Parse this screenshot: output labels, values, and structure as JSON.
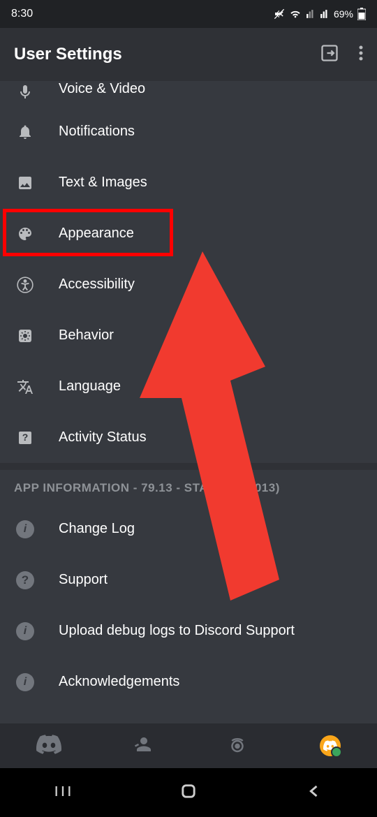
{
  "status": {
    "time": "8:30",
    "battery": "69%"
  },
  "header": {
    "title": "User Settings"
  },
  "items": {
    "voice_video": "Voice & Video",
    "notifications": "Notifications",
    "text_images": "Text & Images",
    "appearance": "Appearance",
    "accessibility": "Accessibility",
    "behavior": "Behavior",
    "language": "Language",
    "activity_status": "Activity Status"
  },
  "section": {
    "app_info": "APP INFORMATION - 79.13 - STABLE (79013)"
  },
  "info_items": {
    "change_log": "Change Log",
    "support": "Support",
    "upload_logs": "Upload debug logs to Discord Support",
    "acknowledgements": "Acknowledgements"
  }
}
